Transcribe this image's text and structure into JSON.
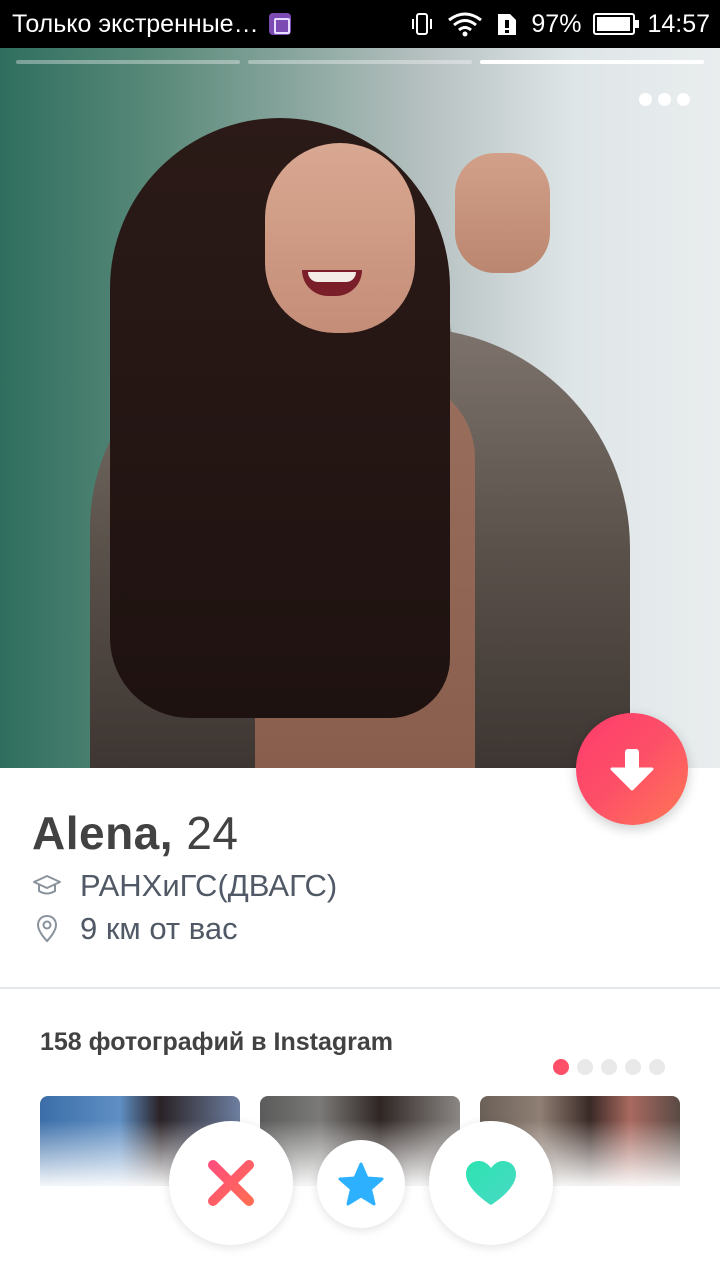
{
  "status_bar": {
    "notification_text": "Только экстренные…",
    "battery": "97%",
    "battery_level": 0.97,
    "time": "14:57",
    "icons": [
      "gallery-icon",
      "vibrate-icon",
      "wifi-icon",
      "sim-icon",
      "battery-icon"
    ]
  },
  "photo": {
    "segments": 3,
    "active_segment": 3
  },
  "profile": {
    "name": "Alena,",
    "age": "24",
    "school": "РАНХиГС(ДВАГС)",
    "distance": "9 км от вас"
  },
  "instagram": {
    "title": "158 фотографий в Instagram",
    "pages": 5,
    "active_page": 1
  },
  "actions": {
    "nope": "nope-icon",
    "super_like": "star-icon",
    "like": "heart-icon"
  },
  "colors": {
    "accent": "#fd5068",
    "super_like": "#2db1ff",
    "like": "#3ce3b4",
    "text": "#424242"
  }
}
